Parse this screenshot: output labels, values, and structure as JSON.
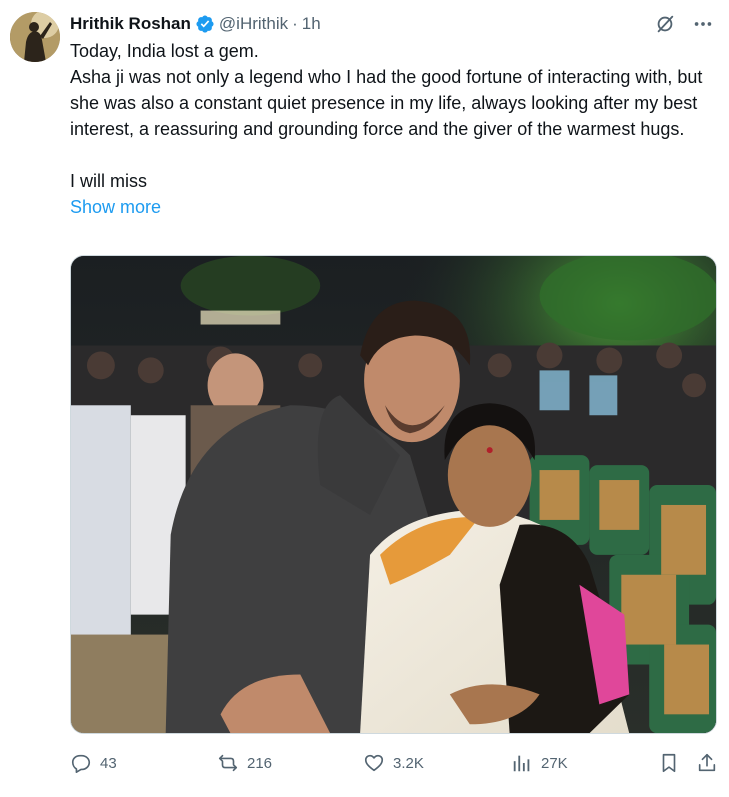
{
  "author": {
    "name": "Hrithik Roshan",
    "handle": "@iHrithik",
    "separator": "·",
    "time": "1h",
    "verified": true
  },
  "tweet": {
    "lines": [
      "Today, India lost a gem.",
      "Asha ji was not only a legend who I had the good fortune of interacting with, but she was also a constant quiet presence in my life, always looking after my best interest, a reassuring and grounding force and the giver of the warmest hugs.",
      "",
      "I will miss"
    ],
    "show_more": "Show more"
  },
  "media": {
    "icon": "photo"
  },
  "actions": {
    "replies": "43",
    "reposts": "216",
    "likes": "3.2K",
    "views": "27K"
  },
  "colors": {
    "text": "#0f1419",
    "secondary": "#536471",
    "link": "#1d9bf0",
    "verified": "#1d9bf0"
  }
}
